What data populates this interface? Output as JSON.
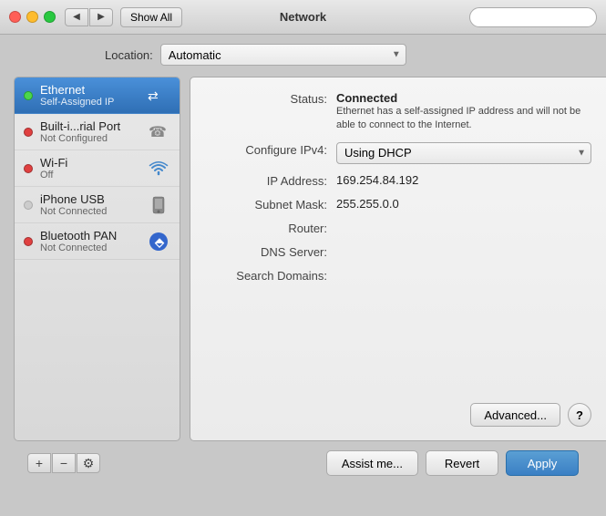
{
  "window": {
    "title": "Network"
  },
  "titlebar": {
    "show_all": "Show All",
    "back_btn": "◀",
    "forward_btn": "▶"
  },
  "location": {
    "label": "Location:",
    "value": "Automatic"
  },
  "sidebar": {
    "items": [
      {
        "id": "ethernet",
        "name": "Ethernet",
        "sub": "Self-Assigned IP",
        "status": "green",
        "active": true
      },
      {
        "id": "builtin",
        "name": "Built-i...rial Port",
        "sub": "Not Configured",
        "status": "red",
        "active": false
      },
      {
        "id": "wifi",
        "name": "Wi-Fi",
        "sub": "Off",
        "status": "red",
        "active": false
      },
      {
        "id": "iphone",
        "name": "iPhone USB",
        "sub": "Not Connected",
        "status": "none",
        "active": false
      },
      {
        "id": "bluetooth",
        "name": "Bluetooth PAN",
        "sub": "Not Connected",
        "status": "red",
        "active": false
      }
    ],
    "add_label": "+",
    "remove_label": "−",
    "gear_label": "⚙"
  },
  "detail": {
    "status_label": "Status:",
    "status_value": "Connected",
    "status_note": "Ethernet has a self-assigned IP address and will not be able to connect to the Internet.",
    "configure_label": "Configure IPv4:",
    "configure_value": "Using DHCP",
    "ip_label": "IP Address:",
    "ip_value": "169.254.84.192",
    "subnet_label": "Subnet Mask:",
    "subnet_value": "255.255.0.0",
    "router_label": "Router:",
    "router_value": "",
    "dns_label": "DNS Server:",
    "dns_value": "",
    "search_label": "Search Domains:",
    "search_value": "",
    "advanced_btn": "Advanced...",
    "help_btn": "?"
  },
  "bottom": {
    "assist_btn": "Assist me...",
    "revert_btn": "Revert",
    "apply_btn": "Apply"
  }
}
